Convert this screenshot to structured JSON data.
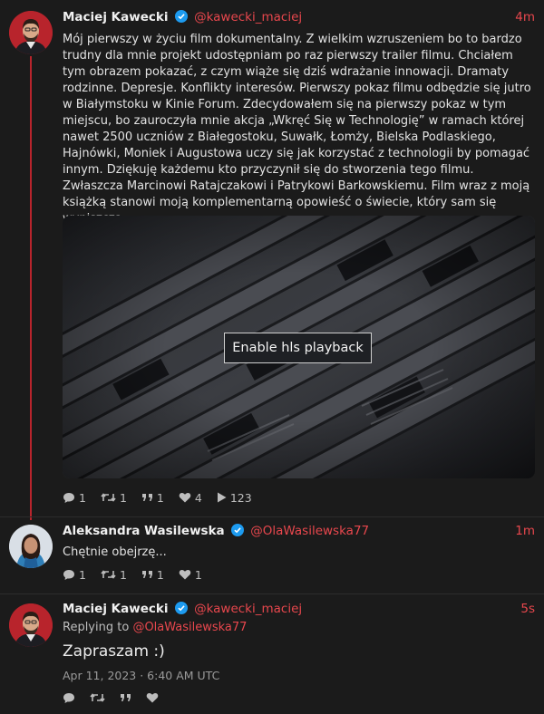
{
  "tweets": [
    {
      "name": "Maciej Kawecki",
      "handle": "@kawecki_maciej",
      "time": "4m",
      "text": "Mój pierwszy w życiu film dokumentalny. Z wielkim wzruszeniem bo to bardzo trudny dla mnie projekt udostępniam po raz pierwszy trailer filmu. Chciałem tym obrazem pokazać, z czym wiąże się dziś wdrażanie innowacji. Dramaty rodzinne. Depresje. Konflikty interesów. Pierwszy pokaz filmu odbędzie się jutro w Białymstoku w Kinie Forum. Zdecydowałem się na pierwszy pokaz w tym miejscu, bo zauroczyła mnie akcja „Wkręć Się w Technologię” w ramach której nawet 2500 uczniów z Białegostoku, Suwałk, Łomży, Bielska Podlaskiego, Hajnówki, Moniek i Augustowa uczy się jak korzystać z technologii by pomagać innym. Dziękuję każdemu kto przyczynił się do stworzenia tego filmu. Zwłaszcza Marcinowi Ratajczakowi i Patrykowi Barkowskiemu. Film wraz z moją książką stanowi moją komplementarną opowieść o świecie, który sam się wyniszcza.",
      "media_button": "Enable hls playback",
      "stats": {
        "replies": "1",
        "retweets": "1",
        "quotes": "1",
        "likes": "4",
        "views": "123"
      }
    },
    {
      "name": "Aleksandra Wasilewska",
      "handle": "@OlaWasilewska77",
      "time": "1m",
      "text": "Chętnie obejrzę...",
      "stats": {
        "replies": "1",
        "retweets": "1",
        "quotes": "1",
        "likes": "1"
      }
    },
    {
      "name": "Maciej Kawecki",
      "handle": "@kawecki_maciej",
      "time": "5s",
      "replying_prefix": "Replying to",
      "replying_handle": "@OlaWasilewska77",
      "text": "Zapraszam :)",
      "date": "Apr 11, 2023 · 6:40 AM UTC"
    }
  ],
  "colors": {
    "accent": "#e8474d",
    "thread": "#b8242c",
    "background": "#1b1b1b",
    "verified": "#1d9bf0"
  }
}
